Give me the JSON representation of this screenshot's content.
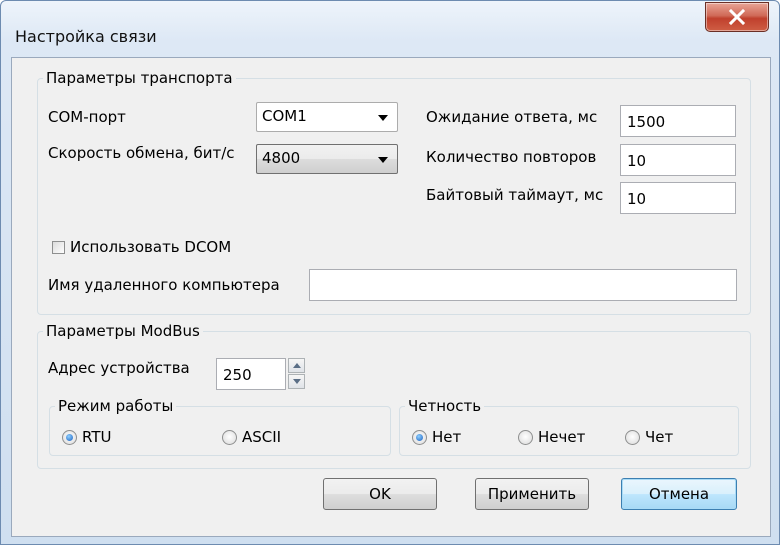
{
  "window": {
    "title": "Настройка связи"
  },
  "transport": {
    "title": "Параметры транспорта",
    "com_port_label": "COM-порт",
    "com_port_value": "COM1",
    "baud_label": "Скорость обмена, бит/с",
    "baud_value": "4800",
    "timeout_label": "Ожидание ответа, мс",
    "timeout_value": "1500",
    "retries_label": "Количество повторов",
    "retries_value": "10",
    "byte_timeout_label": "Байтовый таймаут, мс",
    "byte_timeout_value": "10",
    "dcom_label": "Использовать DCOM",
    "dcom_checked": false,
    "remote_label": "Имя удаленного компьютера",
    "remote_value": ""
  },
  "modbus": {
    "title": "Параметры ModBus",
    "address_label": "Адрес устройства",
    "address_value": "250",
    "mode": {
      "title": "Режим работы",
      "options": [
        "RTU",
        "ASCII"
      ],
      "selected": "RTU"
    },
    "parity": {
      "title": "Четность",
      "options": [
        "Нет",
        "Нечет",
        "Чет"
      ],
      "selected": "Нет"
    }
  },
  "buttons": {
    "ok": "OK",
    "apply": "Применить",
    "cancel": "Отмена"
  },
  "colors": {
    "accent": "#3c7fb1",
    "close": "#c0402d"
  }
}
